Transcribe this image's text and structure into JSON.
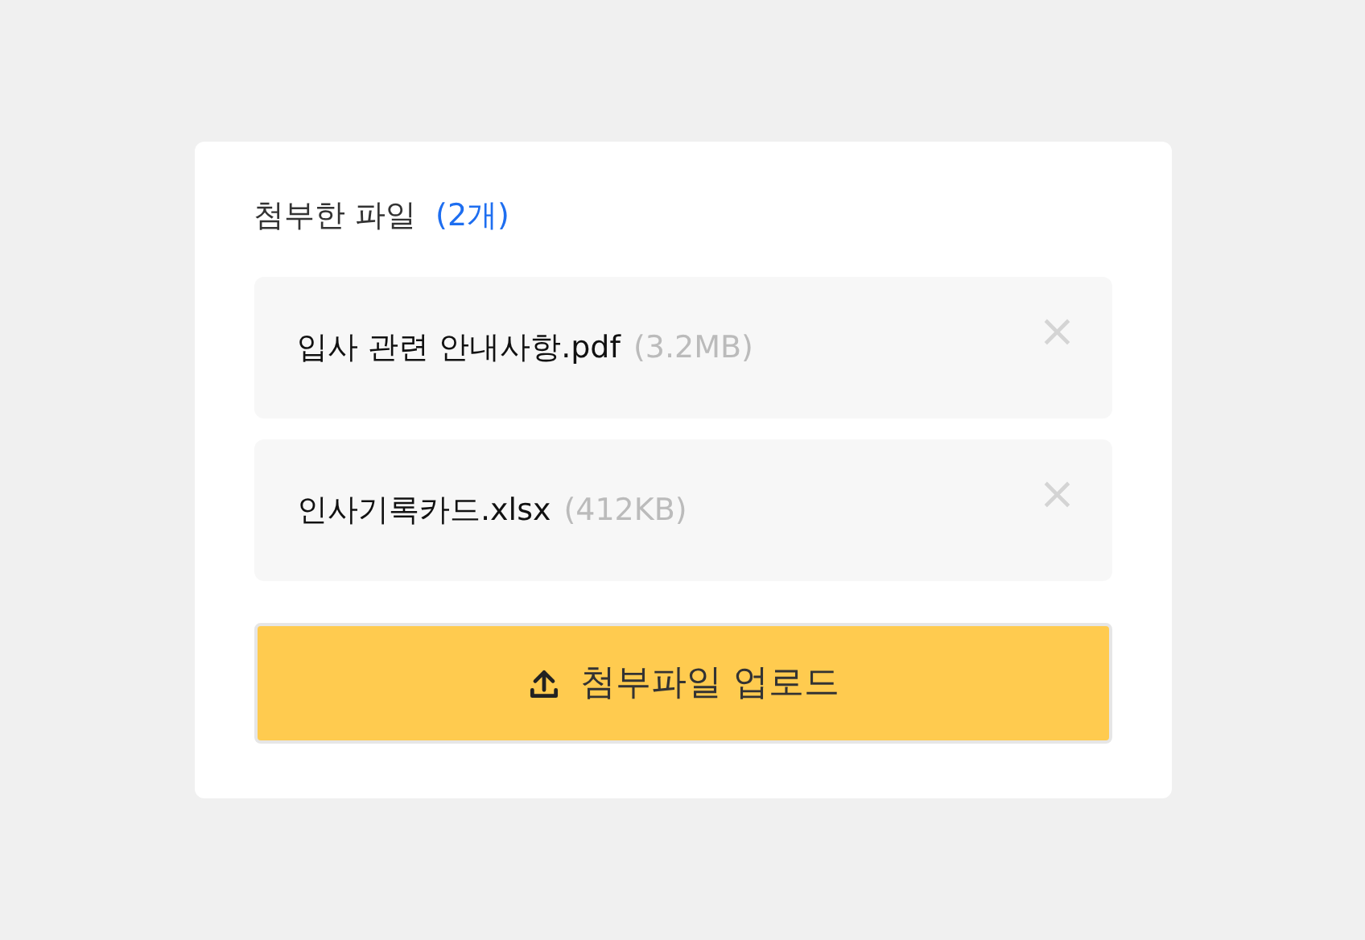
{
  "title": "첨부한 파일",
  "count": "(2개)",
  "files": [
    {
      "name": "입사 관련 안내사항.pdf",
      "size": "(3.2MB)",
      "remove": "×"
    },
    {
      "name": "인사기록카드.xlsx",
      "size": "(412KB)",
      "remove": "×"
    }
  ],
  "upload_button": {
    "label": "첨부파일 업로드"
  }
}
